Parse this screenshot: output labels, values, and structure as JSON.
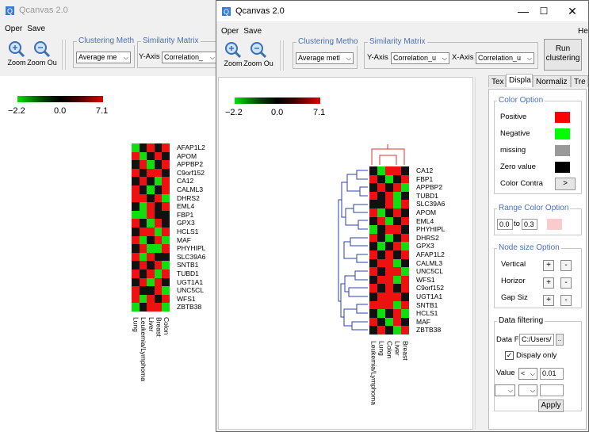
{
  "back_window": {
    "title": "Qcanvas 2.0",
    "menu": [
      "Oper",
      "Save"
    ],
    "zoom_in": "Zoom",
    "zoom_out": "Zoom Ou",
    "clustering_group": "Clustering Meth",
    "clustering_value": "Average me",
    "similarity_group": "Similarity Matrix",
    "y_axis_label": "Y-Axis",
    "y_axis_value": "Correlation_",
    "legend": {
      "min": "−2.2",
      "mid": "0.0",
      "max": "7.1"
    },
    "genes": [
      "AFAP1L2",
      "APOM",
      "APPBP2",
      "C9orf152",
      "CA12",
      "CALML3",
      "DHRS2",
      "EML4",
      "FBP1",
      "GPX3",
      "HCLS1",
      "MAF",
      "PHYHIPL",
      "SLC39A6",
      "SNTB1",
      "TUBD1",
      "UGT1A1",
      "UNC5CL",
      "WFS1",
      "ZBTB38"
    ],
    "columns": [
      "Lung",
      "Leukemia/Lymphoma",
      "Liver",
      "Breast",
      "Colon"
    ],
    "heatmap": [
      [
        "g",
        "k",
        "r",
        "k",
        "r"
      ],
      [
        "r",
        "g",
        "k",
        "r",
        "k"
      ],
      [
        "k",
        "r",
        "g",
        "k",
        "r"
      ],
      [
        "r",
        "k",
        "r",
        "r",
        "k"
      ],
      [
        "k",
        "r",
        "k",
        "g",
        "r"
      ],
      [
        "r",
        "k",
        "g",
        "k",
        "r"
      ],
      [
        "r",
        "r",
        "k",
        "r",
        "g"
      ],
      [
        "k",
        "g",
        "r",
        "k",
        "r"
      ],
      [
        "g",
        "g",
        "r",
        "k",
        "k"
      ],
      [
        "r",
        "k",
        "g",
        "r",
        "k"
      ],
      [
        "k",
        "r",
        "r",
        "g",
        "r"
      ],
      [
        "r",
        "g",
        "k",
        "r",
        "g"
      ],
      [
        "k",
        "r",
        "g",
        "g",
        "r"
      ],
      [
        "r",
        "g",
        "r",
        "k",
        "k"
      ],
      [
        "k",
        "r",
        "k",
        "r",
        "g"
      ],
      [
        "r",
        "k",
        "r",
        "g",
        "r"
      ],
      [
        "k",
        "r",
        "g",
        "r",
        "k"
      ],
      [
        "r",
        "k",
        "k",
        "r",
        "g"
      ],
      [
        "r",
        "g",
        "r",
        "k",
        "r"
      ],
      [
        "g",
        "k",
        "r",
        "r",
        "g"
      ]
    ]
  },
  "front_window": {
    "title": "Qcanvas 2.0",
    "menu": [
      "Oper",
      "Save"
    ],
    "help": "Help",
    "zoom_in": "Zoom",
    "zoom_out": "Zoom Ou",
    "clustering_group": "Clustering Metho",
    "clustering_value": "Average metl",
    "similarity_group": "Similarity Matrix",
    "y_axis_label": "Y-Axis",
    "y_axis_value": "Correlation_u",
    "x_axis_label": "X-Axis",
    "x_axis_value": "Correlation_u",
    "run_button": [
      "Run",
      "clustering"
    ],
    "window_controls": [
      "—",
      "☐",
      "✕"
    ],
    "legend": {
      "min": "−2.2",
      "mid": "0.0",
      "max": "7.1"
    },
    "genes": [
      "CA12",
      "FBP1",
      "APPBP2",
      "TUBD1",
      "SLC39A6",
      "APOM",
      "EML4",
      "PHYHIPL",
      "DHRS2",
      "GPX3",
      "AFAP1L2",
      "CALML3",
      "UNC5CL",
      "WFS1",
      "C9orf152",
      "UGT1A1",
      "SNTB1",
      "HCLS1",
      "MAF",
      "ZBTB38"
    ],
    "columns": [
      "Leukemia/Lymphoma",
      "Lung",
      "Colon",
      "Liver",
      "Breast"
    ],
    "heatmap": [
      [
        "k",
        "g",
        "r",
        "r",
        "k"
      ],
      [
        "r",
        "k",
        "g",
        "k",
        "r"
      ],
      [
        "k",
        "r",
        "k",
        "r",
        "g"
      ],
      [
        "r",
        "k",
        "r",
        "g",
        "k"
      ],
      [
        "k",
        "k",
        "r",
        "g",
        "r"
      ],
      [
        "r",
        "g",
        "k",
        "r",
        "k"
      ],
      [
        "k",
        "r",
        "g",
        "k",
        "r"
      ],
      [
        "g",
        "k",
        "r",
        "r",
        "k"
      ],
      [
        "r",
        "k",
        "g",
        "k",
        "r"
      ],
      [
        "k",
        "g",
        "k",
        "r",
        "g"
      ],
      [
        "r",
        "k",
        "r",
        "k",
        "r"
      ],
      [
        "k",
        "r",
        "r",
        "g",
        "k"
      ],
      [
        "r",
        "k",
        "r",
        "r",
        "g"
      ],
      [
        "k",
        "r",
        "r",
        "g",
        "r"
      ],
      [
        "r",
        "k",
        "r",
        "k",
        "r"
      ],
      [
        "k",
        "r",
        "r",
        "r",
        "k"
      ],
      [
        "r",
        "r",
        "r",
        "g",
        "r"
      ],
      [
        "k",
        "g",
        "k",
        "r",
        "g"
      ],
      [
        "r",
        "k",
        "g",
        "r",
        "k"
      ],
      [
        "k",
        "r",
        "k",
        "g",
        "r"
      ]
    ],
    "tabs": [
      "Tex",
      "Displa",
      "Normaliz",
      "Tre"
    ],
    "color_option": {
      "title": "Color Option",
      "positive": "Positive",
      "negative": "Negative",
      "missing": "missing",
      "zero": "Zero value",
      "contrast": "Color Contra",
      "contrast_btn": ">",
      "colors": {
        "positive": "#ff0000",
        "negative": "#00ff00",
        "missing": "#999999",
        "zero": "#000000"
      }
    },
    "range_option": {
      "title": "Range Color Option",
      "from": "0.0",
      "to_label": "to",
      "to": "0.3"
    },
    "node_size": {
      "title": "Node size Option",
      "vertical": "Vertical",
      "horizontal": "Horizor",
      "gap": "Gap Siz",
      "plus": "+",
      "minus": "-"
    },
    "data_filtering": {
      "title": "Data filtering",
      "data_file_label": "Data File",
      "data_file_value": "C:/Users/",
      "browse": "..",
      "display_only": "Dispaly only",
      "value_label": "Value",
      "operator": "<",
      "threshold": "0.01",
      "apply": "Apply"
    }
  },
  "colors": {
    "red": "#ee1111",
    "green": "#11dd11",
    "black": "#111111",
    "accent": "#4a6fb5"
  }
}
